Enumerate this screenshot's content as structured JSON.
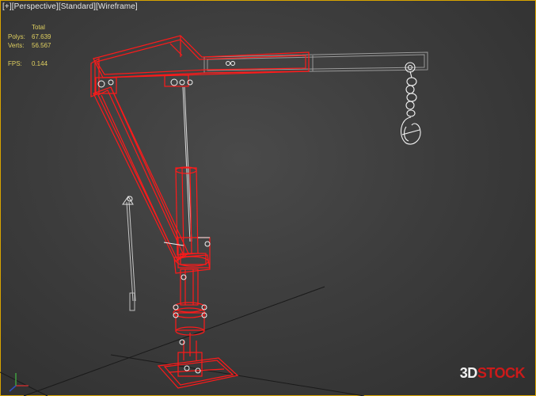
{
  "viewport": {
    "label_parts": [
      "[+]",
      "[Perspective]",
      "[Standard]",
      "[Wireframe]"
    ]
  },
  "stats": {
    "header": "Total",
    "polys_label": "Polys:",
    "polys_value": "67.639",
    "verts_label": "Verts:",
    "verts_value": "56.567",
    "fps_label": "FPS:",
    "fps_value": "0.144"
  },
  "watermark": {
    "part1": "3D",
    "part2": "STOCK"
  },
  "colors": {
    "selection": "#ff1a1a",
    "wire_white": "#e8e8e8",
    "wire_grey": "#9a9a9a",
    "frame": "#d8a400",
    "stats_text": "#e0d060"
  }
}
